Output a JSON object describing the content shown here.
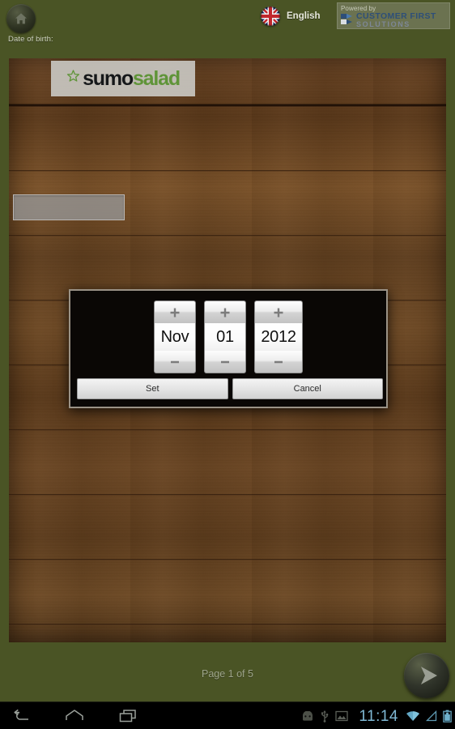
{
  "topbar": {
    "home_icon": "home-icon",
    "dob_label": "Date of birth:",
    "language": "English",
    "flag_icon": "union-jack-flag-icon",
    "powered_by": "Powered by",
    "brand_line1": "CUSTOMER FIRST",
    "brand_line2": "SOLUTIONS"
  },
  "content": {
    "logo_part1": "sumo",
    "logo_part2": "salad",
    "logo_star_icon": "star-flower-icon",
    "dob_input_value": "",
    "dob_input_placeholder": ""
  },
  "date_dialog": {
    "month": {
      "value": "Nov",
      "increment_icon": "plus-icon",
      "decrement_icon": "minus-icon"
    },
    "day": {
      "value": "01",
      "increment_icon": "plus-icon",
      "decrement_icon": "minus-icon"
    },
    "year": {
      "value": "2012",
      "increment_icon": "plus-icon",
      "decrement_icon": "minus-icon"
    },
    "set_label": "Set",
    "cancel_label": "Cancel"
  },
  "footer": {
    "page_indicator": "Page 1 of 5",
    "next_icon": "play-arrow-icon"
  },
  "system_bar": {
    "back_icon": "back-arrow-icon",
    "home_icon": "home-icon",
    "recents_icon": "recent-apps-icon",
    "android_icon": "android-head-icon",
    "usb_icon": "usb-icon",
    "screenshot_icon": "image-icon",
    "clock": "11:14",
    "wifi_icon": "wifi-icon",
    "signal_icon": "signal-triangle-icon",
    "battery_icon": "battery-icon"
  },
  "colors": {
    "background_green": "#4a5425",
    "wood_brown": "#5c3a1e",
    "logo_green": "#5f9438",
    "clock_blue": "#7fb8d4",
    "dialog_black": "#0a0705"
  }
}
